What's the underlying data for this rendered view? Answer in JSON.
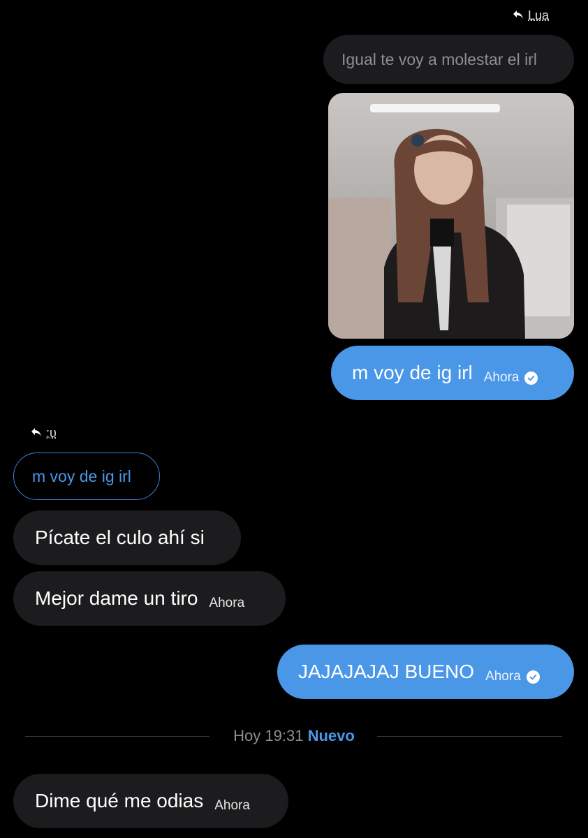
{
  "reply_top": {
    "arrow": "↰",
    "name": "Lua"
  },
  "quoted_top": {
    "text": "Igual te voy a molestar el irl"
  },
  "photo": {
    "description_icon": "shared-photo"
  },
  "msg_sent_1": {
    "text": "m voy de ig irl",
    "time": "Ahora"
  },
  "reply_mid": {
    "arrow": "↰",
    "name": ";υ"
  },
  "quoted_mid": {
    "text": "m voy de ig irl"
  },
  "msg_recv_1": {
    "text": "Pícate el culo ahí si"
  },
  "msg_recv_2": {
    "text": "Mejor dame un tiro",
    "time": "Ahora"
  },
  "msg_sent_2": {
    "text": "JAJAJAJAJ BUENO",
    "time": "Ahora"
  },
  "divider": {
    "time": "Hoy 19:31",
    "label": "Nuevo"
  },
  "msg_recv_3": {
    "text": "Dime qué me odias",
    "time": "Ahora"
  },
  "colors": {
    "sent_bubble": "#4a97e8",
    "received_bubble": "#1c1c1e",
    "background": "#000000"
  }
}
